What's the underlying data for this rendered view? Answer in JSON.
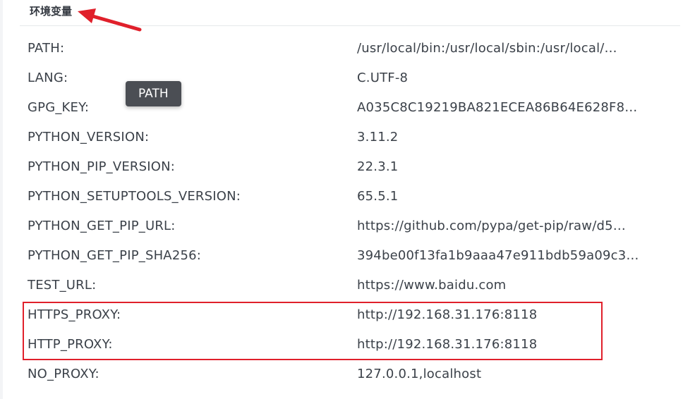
{
  "section": {
    "title": "环境变量"
  },
  "env_vars": [
    {
      "key": "PATH:",
      "value": "/usr/local/bin:/usr/local/sbin:/usr/local/…"
    },
    {
      "key": "LANG:",
      "value": "C.UTF-8"
    },
    {
      "key": "GPG_KEY:",
      "value": "A035C8C19219BA821ECEA86B64E628F8…"
    },
    {
      "key": "PYTHON_VERSION:",
      "value": "3.11.2"
    },
    {
      "key": "PYTHON_PIP_VERSION:",
      "value": "22.3.1"
    },
    {
      "key": "PYTHON_SETUPTOOLS_VERSION:",
      "value": "65.5.1"
    },
    {
      "key": "PYTHON_GET_PIP_URL:",
      "value": "https://github.com/pypa/get-pip/raw/d5…"
    },
    {
      "key": "PYTHON_GET_PIP_SHA256:",
      "value": "394be00f13fa1b9aaa47e911bdb59a09c3…"
    },
    {
      "key": "TEST_URL:",
      "value": "https://www.baidu.com"
    },
    {
      "key": "HTTPS_PROXY:",
      "value": "http://192.168.31.176:8118"
    },
    {
      "key": "HTTP_PROXY:",
      "value": "http://192.168.31.176:8118"
    },
    {
      "key": "NO_PROXY:",
      "value": "127.0.0.1,localhost"
    }
  ],
  "tooltip": {
    "text": "PATH"
  },
  "annotation_color": "#e0202b"
}
